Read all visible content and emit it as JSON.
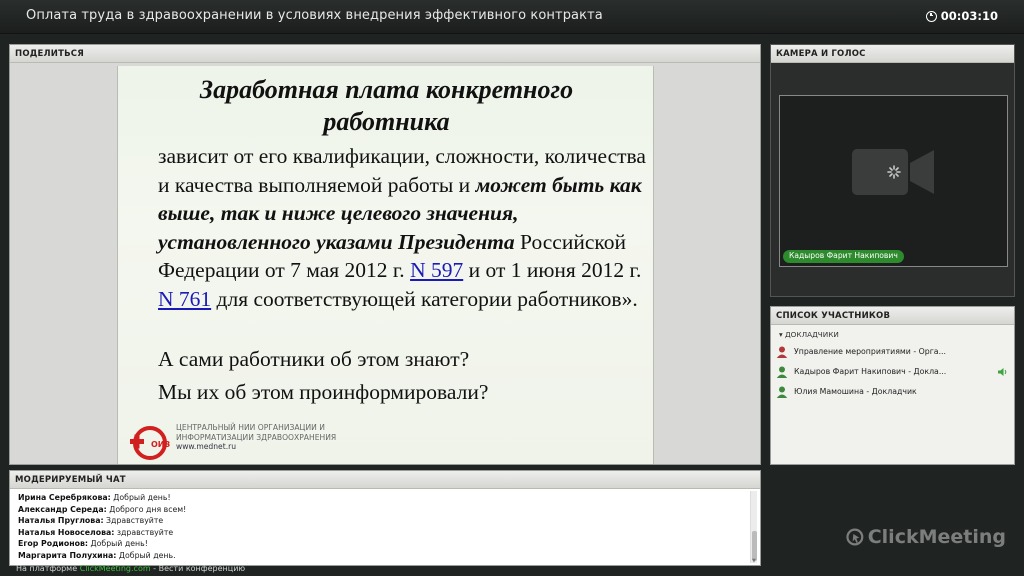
{
  "window": {
    "title": "Оплата труда в здравоохранении в условиях внедрения эффективного контракта",
    "timer": "00:03:10"
  },
  "share": {
    "header": "ПОДЕЛИТЬСЯ",
    "slide": {
      "heading_line1": "Заработная плата конкретного",
      "heading_line2": "работника",
      "body_part1": "зависит от его квалификации, сложности, количества и качества выполняемой работы и ",
      "body_emphasis": "может быть как выше, так и ниже целевого значения, установленного указами Президента",
      "body_part2": " Российской Федерации от 7 мая 2012 г. ",
      "link1": "N 597",
      "body_part3": " и от 1 июня 2012 г. ",
      "link2": "N 761",
      "body_part4": " для соответствующей категории работников».",
      "question1": "А сами работники об этом знают?",
      "question2": "Мы их об этом проинформировали?",
      "logo_text": "ОИЗ",
      "org_line1": "ЦЕНТРАЛЬНЫЙ НИИ ОРГАНИЗАЦИИ И",
      "org_line2": "ИНФОРМАТИЗАЦИИ ЗДРАВООХРАНЕНИЯ",
      "org_site": "www.mednet.ru"
    }
  },
  "camera": {
    "header": "КАМЕРА И ГОЛОС",
    "presenter_name": "Кадыров Фарит Накипович"
  },
  "participants": {
    "header": "СПИСОК УЧАСТНИКОВ",
    "group_label": "ДОКЛАДЧИКИ",
    "items": [
      {
        "name": "Управление мероприятиями - Орга...",
        "role_color": "#b03a3a"
      },
      {
        "name": "Кадыров Фарит Накипович - Докла...",
        "role_color": "#3d8a3d"
      },
      {
        "name": "Юлия Мамошина - Докладчик",
        "role_color": "#3d8a3d"
      }
    ]
  },
  "chat": {
    "header": "МОДЕРИРУЕМЫЙ ЧАТ",
    "messages": [
      {
        "author": "Ирина Серебрякова:",
        "text": " Добрый день!"
      },
      {
        "author": "Александр Середа:",
        "text": " Доброго дня всем!"
      },
      {
        "author": "Наталья Пруглова:",
        "text": " Здравствуйте"
      },
      {
        "author": "Наталья Новоселова:",
        "text": " здравствуйте"
      },
      {
        "author": "Егор Родионов:",
        "text": " Добрый день!"
      },
      {
        "author": "Маргарита  Полухина:",
        "text": " Добрый день."
      }
    ]
  },
  "footer": {
    "prefix": "На платформе ",
    "brand": "ClickMeeting.com",
    "suffix": " - Вести конференцию"
  },
  "watermark": {
    "text": "ClickMeeting"
  }
}
